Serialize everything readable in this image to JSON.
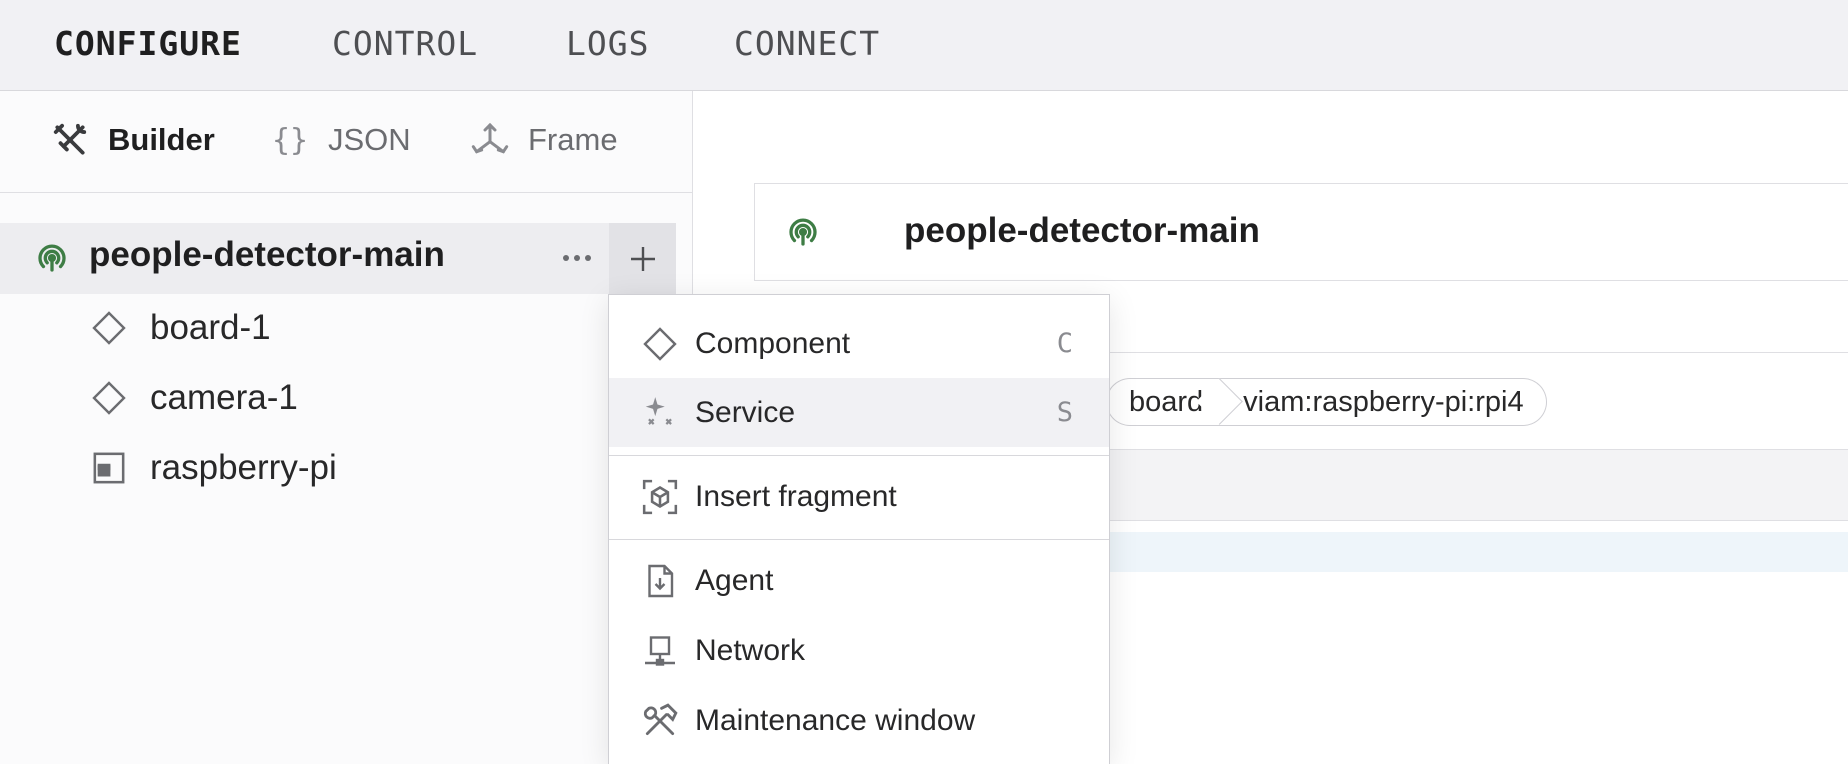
{
  "topnav": {
    "tabs": [
      {
        "label": "CONFIGURE",
        "active": true
      },
      {
        "label": "CONTROL",
        "active": false
      },
      {
        "label": "LOGS",
        "active": false
      },
      {
        "label": "CONNECT",
        "active": false
      }
    ]
  },
  "sidebar": {
    "modes": [
      {
        "label": "Builder",
        "icon": "tools-icon",
        "active": true
      },
      {
        "label": "JSON",
        "icon": "braces-icon",
        "active": false
      },
      {
        "label": "Frame",
        "icon": "axes-icon",
        "active": false
      }
    ],
    "root": {
      "name": "people-detector-main",
      "status_icon": "online-signal-icon"
    },
    "items": [
      {
        "name": "board-1",
        "icon": "diamond-icon"
      },
      {
        "name": "camera-1",
        "icon": "diamond-icon"
      },
      {
        "name": "raspberry-pi",
        "icon": "board-chip-icon"
      }
    ]
  },
  "main": {
    "header_name": "people-detector-main",
    "chips": [
      "board",
      "viam:raspberry-pi:rpi4"
    ]
  },
  "menu": {
    "items": [
      {
        "label": "Component",
        "key": "C",
        "icon": "diamond-icon"
      },
      {
        "label": "Service",
        "key": "S",
        "icon": "sparkle-icon"
      },
      {
        "label": "Insert fragment",
        "key": "",
        "icon": "fragment-icon"
      },
      {
        "label": "Agent",
        "key": "",
        "icon": "file-download-icon"
      },
      {
        "label": "Network",
        "key": "",
        "icon": "network-icon"
      },
      {
        "label": "Maintenance window",
        "key": "",
        "icon": "hammer-wrench-icon"
      }
    ]
  },
  "colors": {
    "status_green": "#3e7d45",
    "icon_gray": "#8a8b90",
    "nav_bg": "#f1f1f4",
    "hover_bg": "#f1f1f4"
  }
}
